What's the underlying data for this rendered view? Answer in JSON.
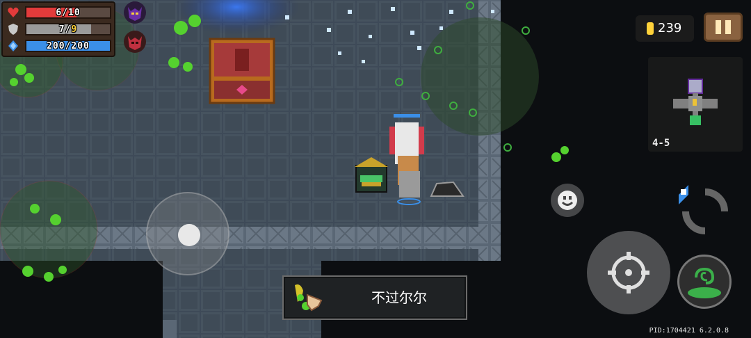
{
  "hud": {
    "health": {
      "current": 6,
      "max": 10,
      "text": "6/10",
      "color": "#e33b3b"
    },
    "armor": {
      "current": 7,
      "max": 9,
      "text_current": "7/",
      "text_max": "9",
      "color": "#9a9a9a"
    },
    "energy": {
      "current": 200,
      "max": 200,
      "text": "200/200",
      "color": "#3b8fe8"
    },
    "buffs": [
      {
        "icon": "purple-demon-mask-icon"
      },
      {
        "icon": "red-demon-mask-icon"
      }
    ]
  },
  "coins": {
    "value": "239",
    "icon": "coin-icon"
  },
  "pause": {
    "icon": "pause-icon"
  },
  "minimap": {
    "floor_label": "4-5"
  },
  "weapon": {
    "name": "不过尔尔",
    "icon": "weapon-icon"
  },
  "controls": {
    "joystick": "move-joystick",
    "emote_icon": "smiley-icon",
    "attack_icon": "crosshair-icon",
    "swap_icon": "weapon-swap-icon",
    "skill_icon": "green-vortex-skill-icon"
  },
  "footer": {
    "pid": "PID:1704421 6.2.0.8"
  }
}
